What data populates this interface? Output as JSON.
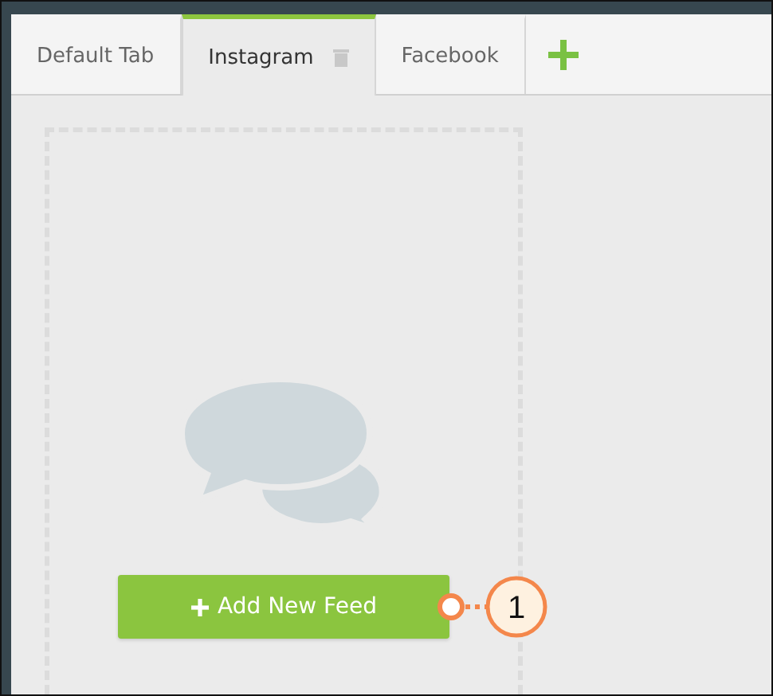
{
  "tabs": [
    {
      "label": "Default Tab",
      "selected": false
    },
    {
      "label": "Instagram",
      "selected": true
    },
    {
      "label": "Facebook",
      "selected": false
    }
  ],
  "feed_panel": {
    "add_button": "Add New Feed"
  },
  "callout": {
    "number": "1"
  }
}
